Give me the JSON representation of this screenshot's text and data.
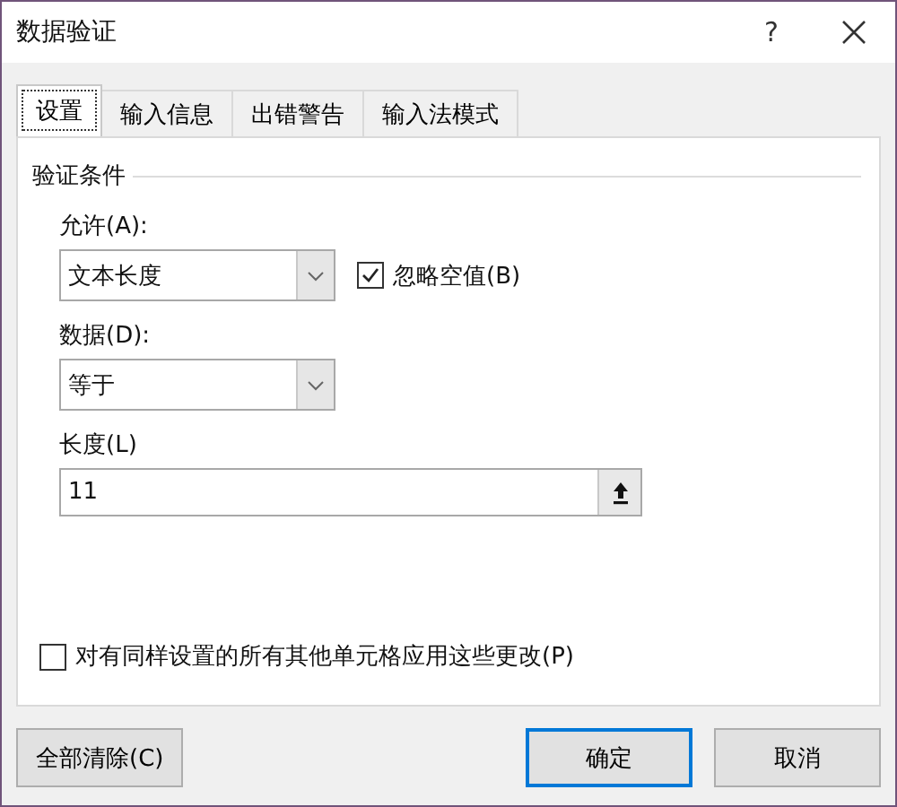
{
  "window": {
    "title": "数据验证",
    "help": "?"
  },
  "tabs": [
    {
      "label": "设置",
      "selected": true
    },
    {
      "label": "输入信息",
      "selected": false
    },
    {
      "label": "出错警告",
      "selected": false
    },
    {
      "label": "输入法模式",
      "selected": false
    }
  ],
  "section_title": "验证条件",
  "allow": {
    "label": "允许(A):",
    "value": "文本长度"
  },
  "ignore_blank": {
    "label": "忽略空值(B)",
    "checked": true
  },
  "data": {
    "label": "数据(D):",
    "value": "等于"
  },
  "length": {
    "label": "长度(L)",
    "value": "11"
  },
  "apply_all": {
    "label": "对有同样设置的所有其他单元格应用这些更改(P)",
    "checked": false
  },
  "buttons": [
    {
      "label": "全部清除(C)",
      "default": false
    },
    {
      "label": "确定",
      "default": true
    },
    {
      "label": "取消",
      "default": false
    }
  ]
}
